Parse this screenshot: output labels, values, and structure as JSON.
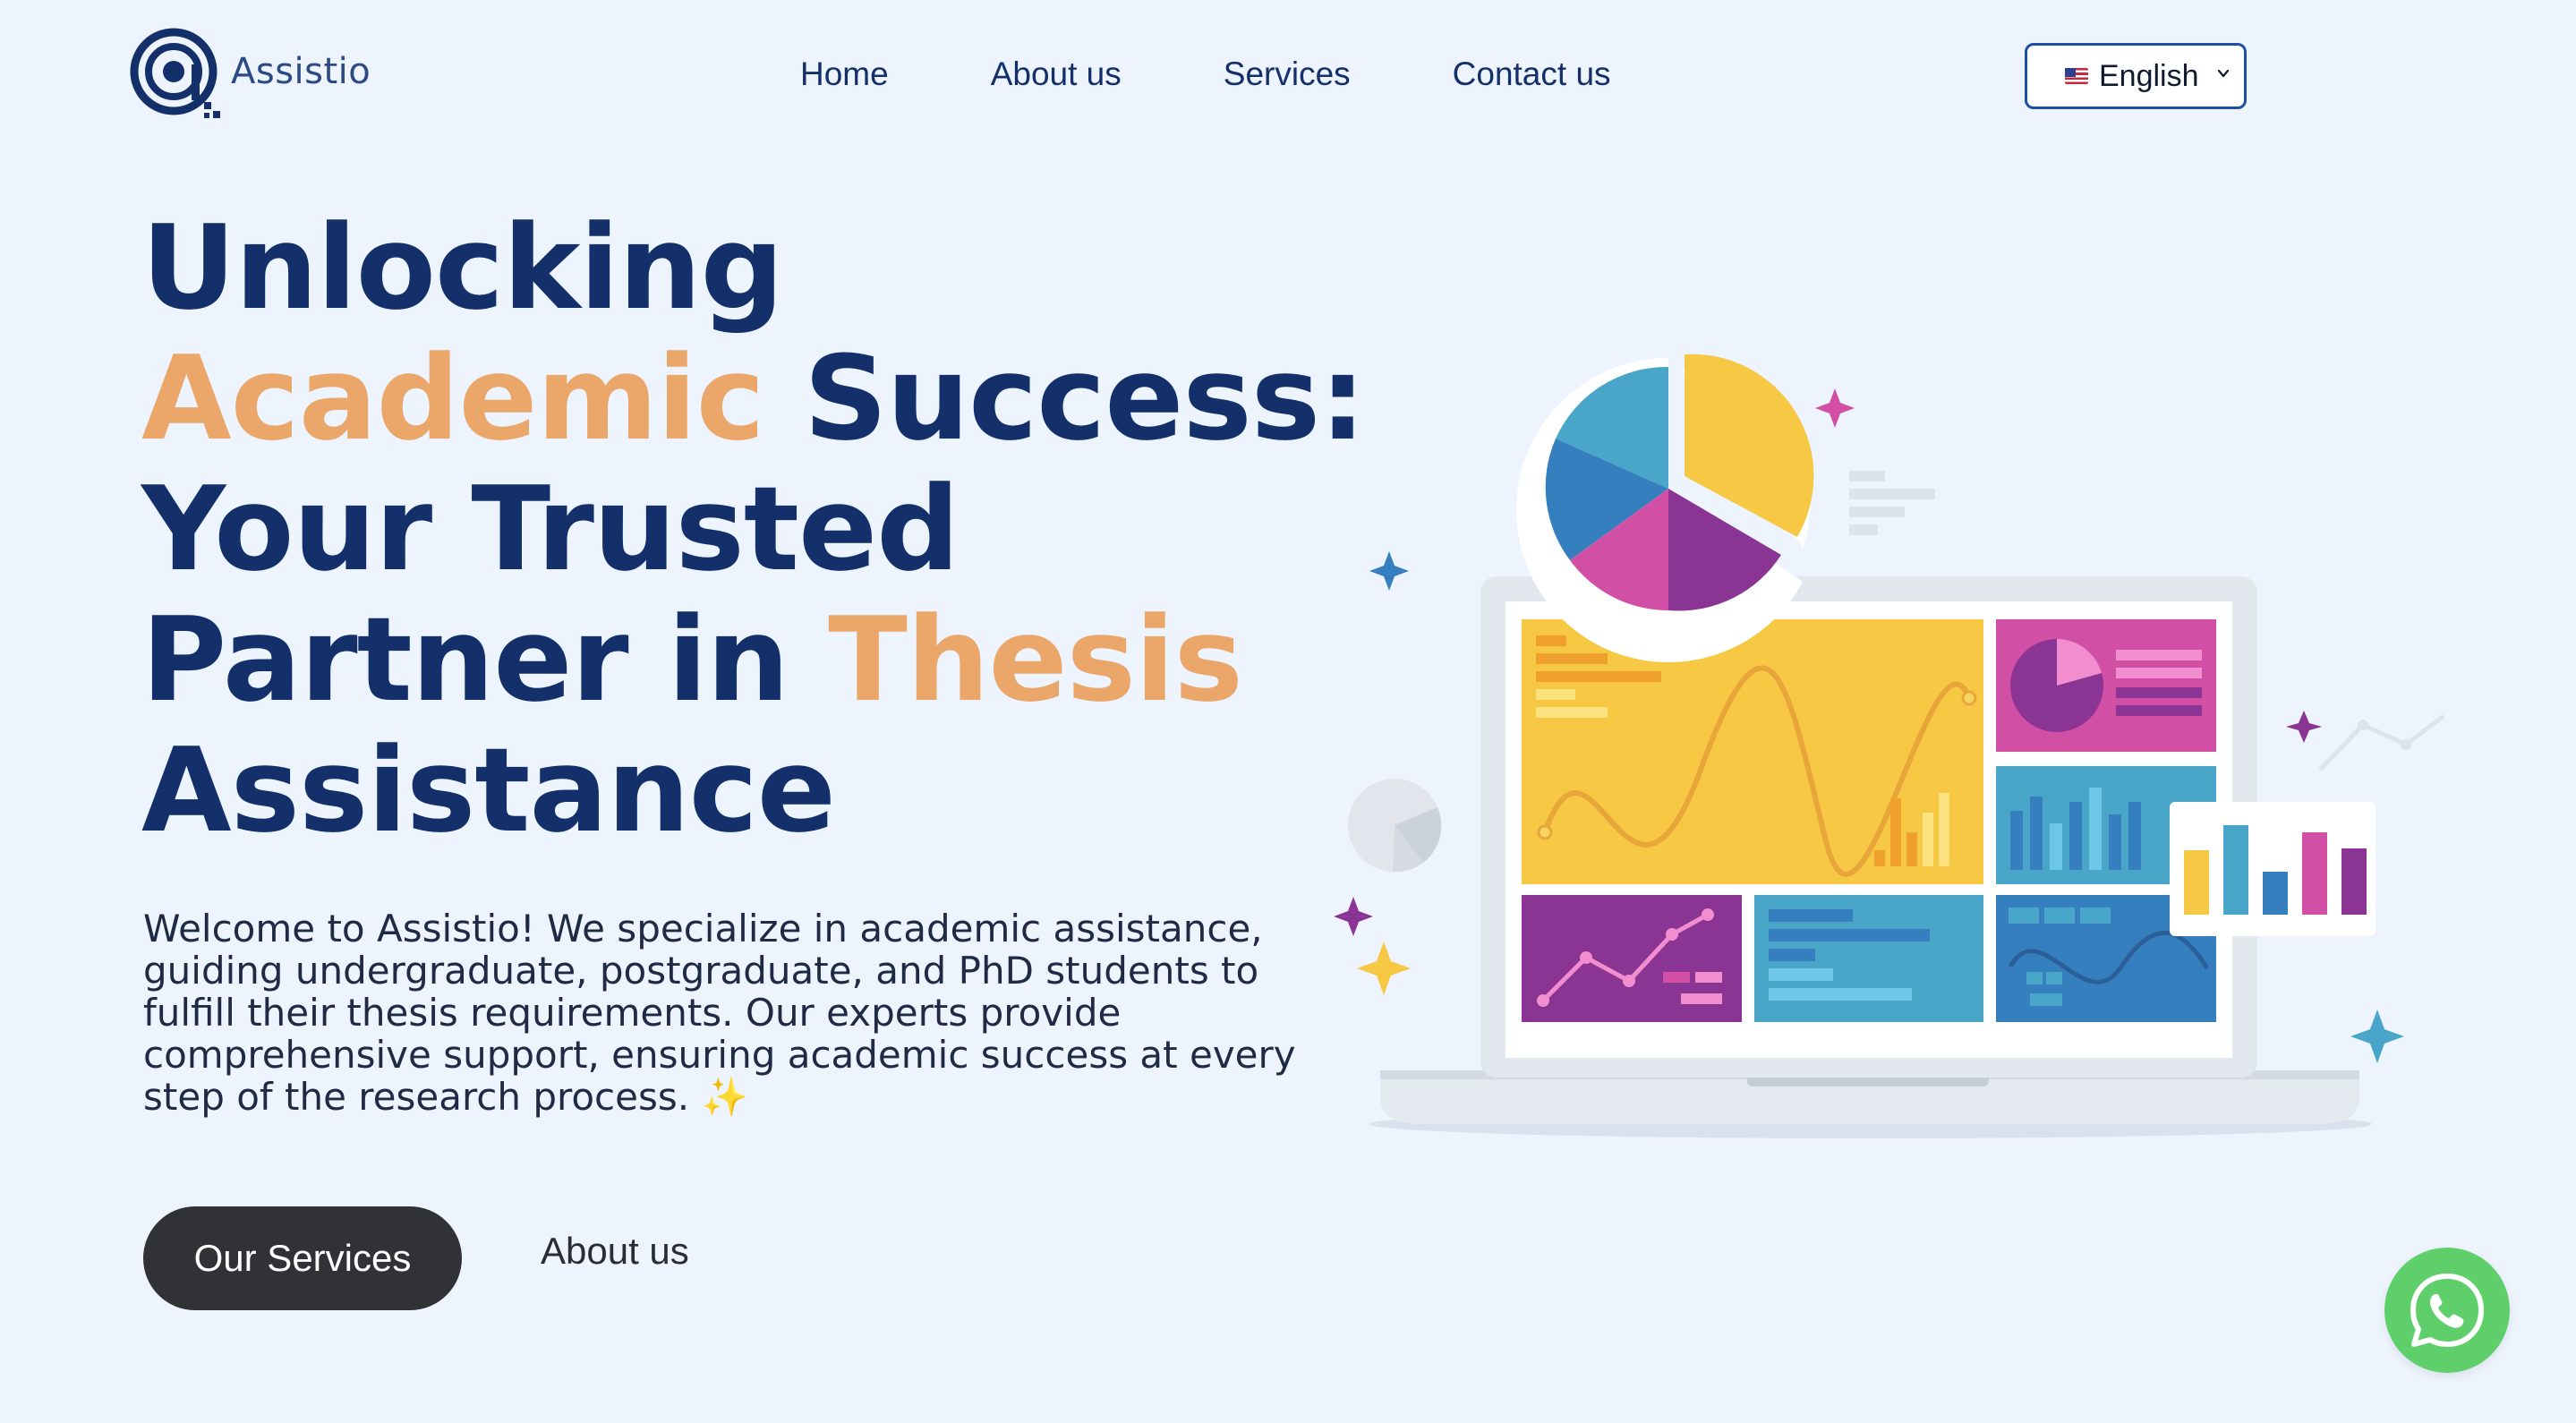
{
  "brand": {
    "name": "Assistio",
    "logo_icon": "at-sign-logo-icon",
    "primary_color": "#13306b",
    "accent_color": "#eba66a"
  },
  "nav": {
    "items": [
      {
        "label": "Home"
      },
      {
        "label": "About us"
      },
      {
        "label": "Services"
      },
      {
        "label": "Contact us"
      }
    ]
  },
  "language": {
    "selected": "English",
    "flag_icon": "us-flag-icon"
  },
  "hero": {
    "headline": {
      "line1": "Unlocking",
      "line2_accent": "Academic",
      "line2_rest": " Success:",
      "line3": "Your Trusted",
      "line4_start": "Partner in ",
      "line4_accent": "Thesis",
      "line5": "Assistance"
    },
    "description": "Welcome to Assistio! We specialize in academic assistance, guiding undergraduate, postgraduate, and PhD students to fulfill their thesis requirements. Our experts provide comprehensive support, ensuring academic success at every step of the research process.",
    "description_emoji": "✨",
    "primary_button": "Our Services",
    "secondary_link": "About us"
  },
  "illustration": {
    "icon": "analytics-laptop-illustration",
    "colors": {
      "yellow": "#f6c844",
      "pink": "#d24fa6",
      "purple": "#8a3594",
      "blue": "#4aa6c8",
      "dark_blue": "#367fbf"
    }
  },
  "whatsapp": {
    "icon": "whatsapp-icon",
    "color": "#5fcf6b"
  }
}
